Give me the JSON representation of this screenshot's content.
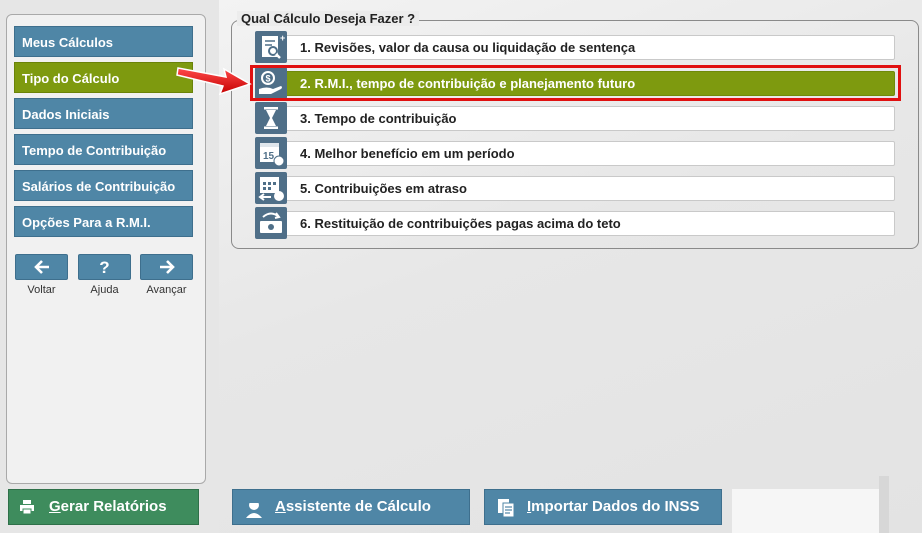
{
  "sidebar": {
    "items": [
      {
        "label": "Meus Cálculos"
      },
      {
        "label": "Tipo do Cálculo"
      },
      {
        "label": "Dados Iniciais"
      },
      {
        "label": "Tempo de Contribuição"
      },
      {
        "label": "Salários de Contribuição"
      },
      {
        "label": "Opções Para a R.M.I."
      }
    ],
    "active_index": 1,
    "controls": {
      "back_label": "Voltar",
      "help_label": "Ajuda",
      "forward_label": "Avançar",
      "back_icon": "arrow-left-icon",
      "help_icon": "question-icon",
      "forward_icon": "arrow-right-icon"
    },
    "report_button": {
      "first_letter": "G",
      "rest": "erar Relatórios",
      "icon": "printer-icon"
    }
  },
  "main": {
    "legend": "Qual Cálculo Deseja Fazer ?",
    "options": [
      {
        "label": "1. Revisões, valor da causa ou liquidação de sentença",
        "icon": "document-search-icon"
      },
      {
        "label": "2. R.M.I., tempo de contribuição e planejamento futuro",
        "icon": "hand-money-icon"
      },
      {
        "label": "3. Tempo de contribuição",
        "icon": "hourglass-icon"
      },
      {
        "label": "4. Melhor benefício em um período",
        "icon": "calendar-15-icon"
      },
      {
        "label": "5. Contribuições em atraso",
        "icon": "calendar-money-icon"
      },
      {
        "label": "6. Restituição de contribuições pagas acima do teto",
        "icon": "money-refund-icon"
      }
    ],
    "selected_index": 1,
    "calendar_day": "15"
  },
  "footer": {
    "assistant_button": {
      "first_letter": "A",
      "rest": "ssistente de Cálculo",
      "icon": "assistant-icon"
    },
    "import_button": {
      "first_letter": "I",
      "rest": "mportar Dados do INSS",
      "icon": "import-document-icon"
    }
  },
  "colors": {
    "accent_blue": "#4f86a6",
    "active_green": "#7e9a0f",
    "report_green": "#3e8c5d",
    "highlight_red": "#e01010"
  }
}
